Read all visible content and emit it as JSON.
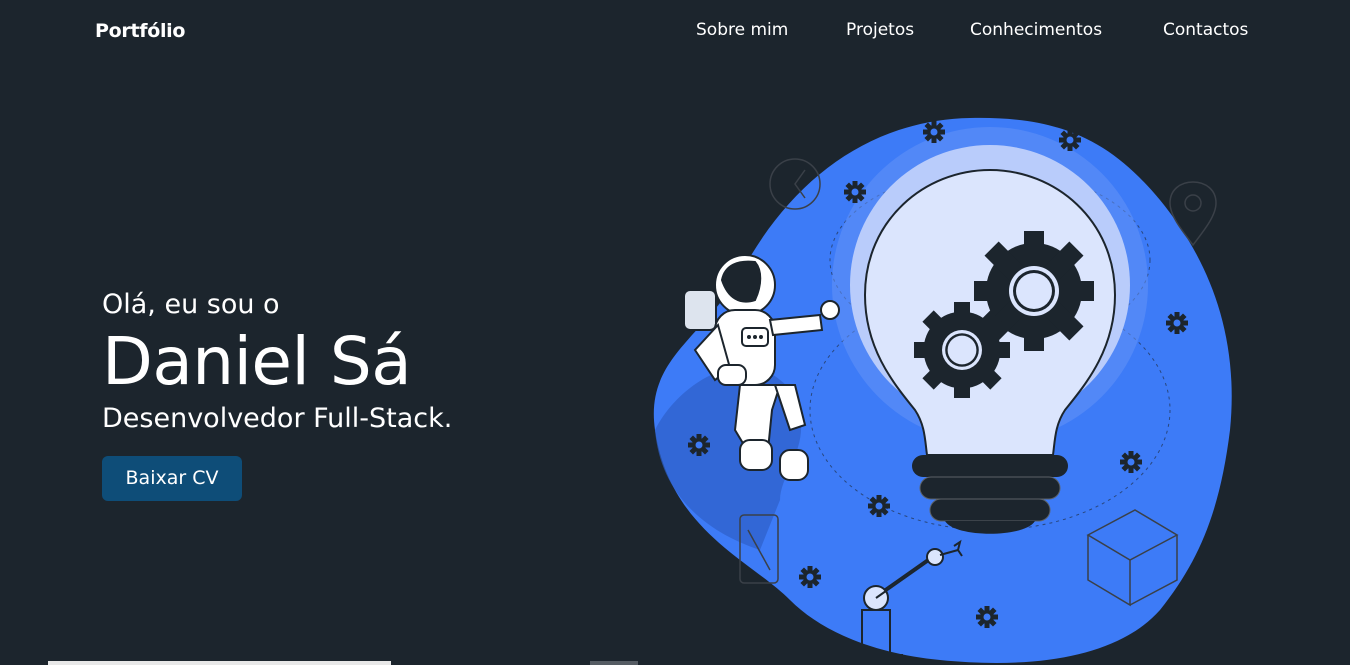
{
  "brand": "Portfólio",
  "nav": {
    "items": [
      {
        "label": "Sobre mim"
      },
      {
        "label": "Projetos"
      },
      {
        "label": "Conhecimentos"
      },
      {
        "label": "Contactos"
      }
    ]
  },
  "hero": {
    "greeting": "Olá, eu sou o",
    "name": "Daniel Sá",
    "role": "Desenvolvedor Full-Stack.",
    "cv_button": "Baixar CV"
  },
  "colors": {
    "background": "#1c252d",
    "accent_blue": "#3d7bf7",
    "button": "#0e4d78"
  },
  "illustration": {
    "icons": [
      "astronaut",
      "light-bulb-icon",
      "gear-icon",
      "robot-arm-icon",
      "smartphone-icon",
      "box-icon",
      "map-pin-icon",
      "clock-icon"
    ]
  }
}
